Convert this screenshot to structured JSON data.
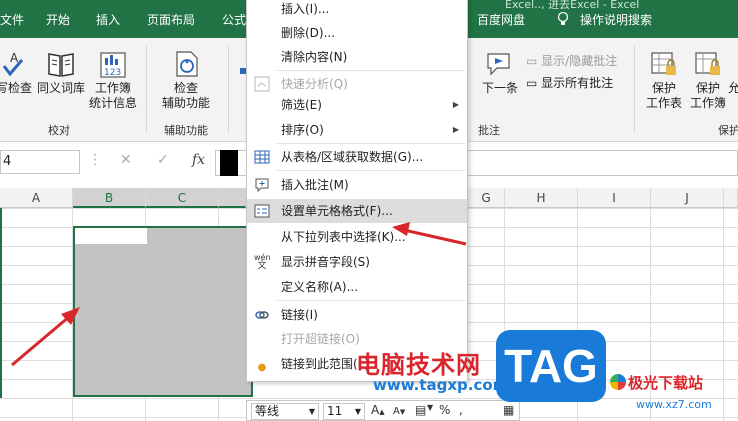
{
  "window": {
    "title_fragment": "Excel.., 进去Excel - Excel"
  },
  "tabs": [
    {
      "label": "文件"
    },
    {
      "label": "开始"
    },
    {
      "label": "插入"
    },
    {
      "label": "页面布局"
    },
    {
      "label": "公式"
    },
    {
      "label": "百度网盘"
    },
    {
      "label": "操作说明搜索"
    }
  ],
  "ribbon": {
    "proofing": {
      "group_label": "校对",
      "spelling": "拼写检查",
      "thesaurus": "同义词库",
      "stats_line1": "工作簿",
      "stats_line2": "统计信息"
    },
    "accessibility": {
      "group_label": "辅助功能",
      "check_line1": "检查",
      "check_line2": "辅助功能"
    },
    "comments": {
      "group_label": "批注",
      "next": "下一条",
      "show_hide": "显示/隐藏批注",
      "show_all": "显示所有批注"
    },
    "protect": {
      "group_label": "保护",
      "sheet_line1": "保护",
      "sheet_line2": "工作表",
      "workbook_line1": "保护",
      "workbook_line2": "工作簿",
      "share_frag": "允"
    }
  },
  "formula_bar": {
    "name_box": "4",
    "cancel": "✕",
    "enter": "✓",
    "fx": "fx"
  },
  "columns": [
    "A",
    "B",
    "C",
    "G",
    "H",
    "I",
    "J"
  ],
  "context_menu": {
    "items": [
      {
        "label": "插入(I)..."
      },
      {
        "label": "删除(D)..."
      },
      {
        "label": "清除内容(N)"
      },
      {
        "label": "快速分析(Q)"
      },
      {
        "label": "筛选(E)"
      },
      {
        "label": "排序(O)"
      },
      {
        "label": "从表格/区域获取数据(G)..."
      },
      {
        "label": "插入批注(M)"
      },
      {
        "label": "设置单元格格式(F)..."
      },
      {
        "label": "从下拉列表中选择(K)..."
      },
      {
        "label": "显示拼音字段(S)"
      },
      {
        "label": "定义名称(A)..."
      },
      {
        "label": "链接(I)"
      },
      {
        "label": "打开超链接(O)"
      },
      {
        "label": "链接到此范围(L)"
      }
    ],
    "pinyin_icon_text": "wén"
  },
  "mini_toolbar": {
    "font": "等线",
    "size": "11",
    "grow": "A",
    "shrink": "A",
    "percent": "%",
    "comma": ","
  },
  "watermark": {
    "site_name": "电脑技术网",
    "site_url": "www.tagxp.com",
    "badge": "TAG",
    "jiguang": "极光下载站",
    "jiguang_url": "www.xz7.com"
  }
}
